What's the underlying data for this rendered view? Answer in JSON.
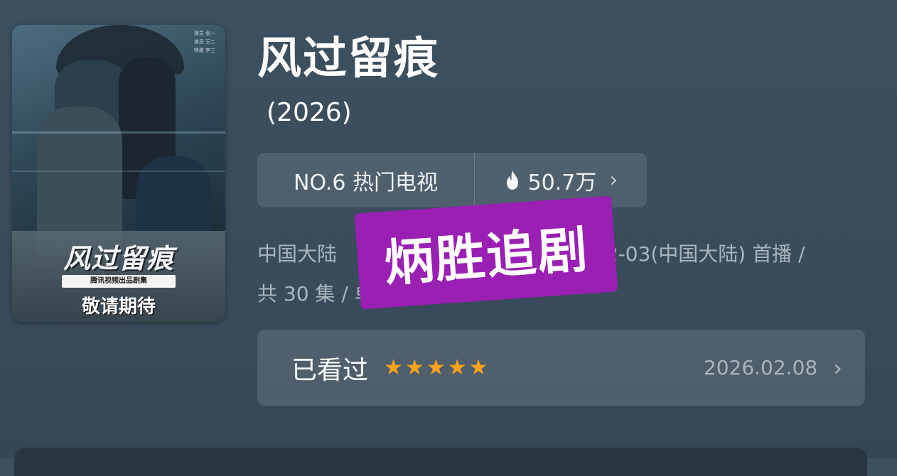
{
  "poster": {
    "title": "风过留痕",
    "subtitle": "腾讯视频出品剧集",
    "coming": "敬请期待",
    "credits": [
      "演员 张一",
      "演员 王二",
      "特邀 李三"
    ]
  },
  "show": {
    "title": "风过留痕",
    "year": "(2026)"
  },
  "ranking": {
    "rank_label": "NO.6 热门电视",
    "heat_value": "50.7万",
    "chevron": "›"
  },
  "meta": {
    "line1_left": "中国大陆",
    "line1_right": "02-03(中国大陆) 首播 /",
    "line2_left": "共 30 集 / 单集片长"
  },
  "watermark": {
    "text": "炳胜追剧",
    "color": "#9a1fb3"
  },
  "watched": {
    "label": "已看过",
    "rating_stars": 5,
    "date": "2026.02.08",
    "chevron": "›",
    "star_color": "#f7a21b"
  },
  "icons": {
    "flame": "flame-icon",
    "star": "star-icon",
    "chevron": "chevron-right-icon"
  }
}
